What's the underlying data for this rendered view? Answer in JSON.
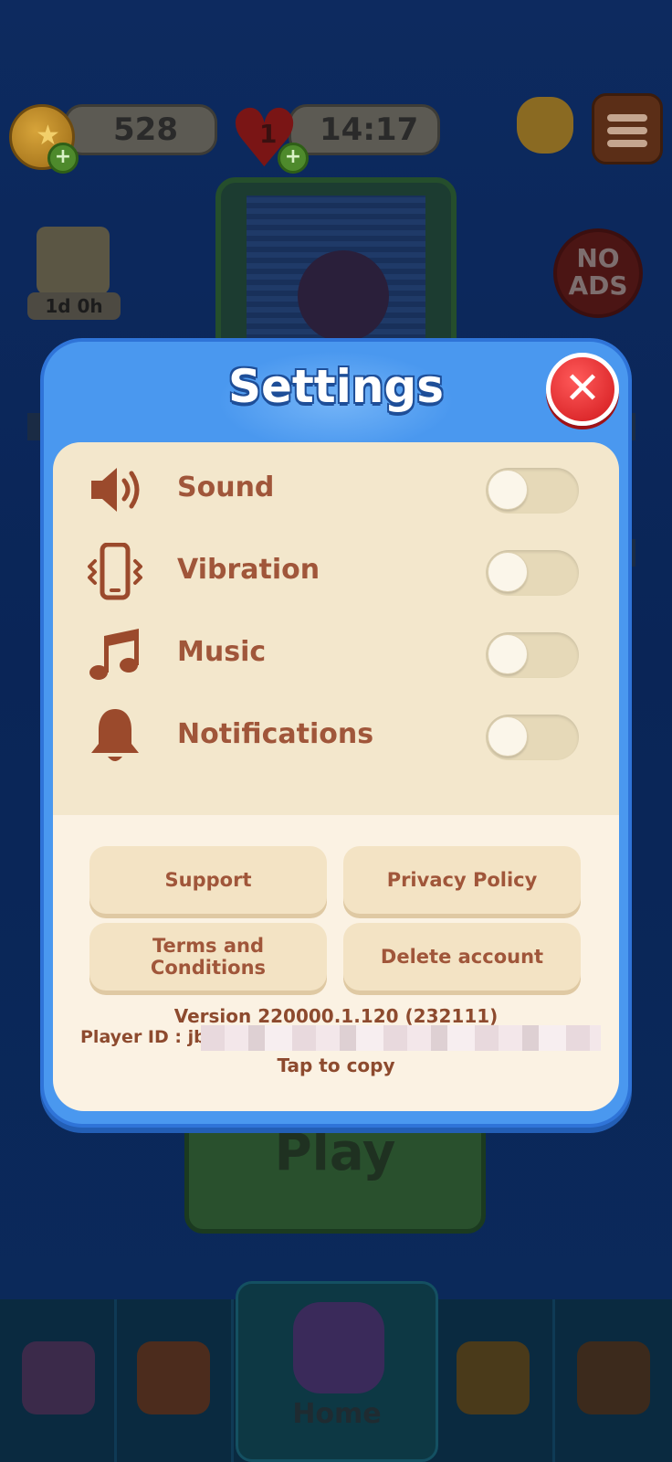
{
  "background": {
    "coins": "528",
    "lives": "1",
    "life_timer": "14:17",
    "quest_timer": "1d 0h",
    "no_ads_label": "NO ADS",
    "play_label": "Play",
    "nav": {
      "active_label": "Home",
      "items": [
        "cards-icon",
        "shop-basket-icon",
        "home-icon",
        "trophy-icon",
        "shield-icon"
      ]
    }
  },
  "dialog": {
    "title": "Settings",
    "close_icon": "close-icon",
    "settings": [
      {
        "label": "Sound",
        "icon": "speaker-icon",
        "on": false
      },
      {
        "label": "Vibration",
        "icon": "vibration-phone-icon",
        "on": false
      },
      {
        "label": "Music",
        "icon": "music-note-icon",
        "on": false
      },
      {
        "label": "Notifications",
        "icon": "bell-icon",
        "on": false
      }
    ],
    "buttons": {
      "support": "Support",
      "privacy": "Privacy Policy",
      "terms": "Terms and Conditions",
      "delete": "Delete account"
    },
    "version": "Version 220000.1.120 (232111)",
    "player_id_label": "Player ID : jb_",
    "tap_to_copy": "Tap to copy"
  },
  "colors": {
    "dialog_blue": "#4a98ef",
    "panel_cream": "#f3e7cc",
    "label_brown": "#a0563a",
    "close_red": "#e02025"
  }
}
